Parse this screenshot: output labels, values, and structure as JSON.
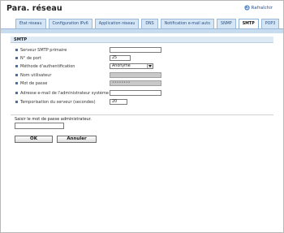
{
  "page": {
    "title": "Para. réseau",
    "refresh_label": "Rafraîchir"
  },
  "tabs": [
    {
      "label": "Etat réseau",
      "active": false
    },
    {
      "label": "Configuration IPv6",
      "active": false
    },
    {
      "label": "Application réseau",
      "active": false
    },
    {
      "label": "DNS",
      "active": false
    },
    {
      "label": "Notification e-mail auto",
      "active": false
    },
    {
      "label": "SNMP",
      "active": false
    },
    {
      "label": "SMTP",
      "active": true
    },
    {
      "label": "POP3",
      "active": false
    }
  ],
  "section": {
    "title": "SMTP"
  },
  "form": {
    "smtp_server": {
      "label": "Serveur SMTP primaire",
      "value": ""
    },
    "port": {
      "label": "N° de port",
      "value": "25"
    },
    "auth_method": {
      "label": "Méthode d'authentification",
      "value": "Anonyme"
    },
    "username": {
      "label": "Nom utilisateur",
      "value": ""
    },
    "password": {
      "label": "Mot de passe",
      "value": "••••••••"
    },
    "admin_email": {
      "label": "Adresse e-mail de l'administrateur système",
      "value": ""
    },
    "timeout": {
      "label": "Temporisation du serveur (secondes)",
      "value": "20"
    }
  },
  "admin_password": {
    "label": "Saisir le mot de passe administrateur.",
    "value": ""
  },
  "buttons": {
    "ok": "OK",
    "cancel": "Annuler"
  },
  "colors": {
    "tab_bg": "#d4e6f5",
    "section_bg": "#dde9f5",
    "link": "#2a4e8a"
  }
}
